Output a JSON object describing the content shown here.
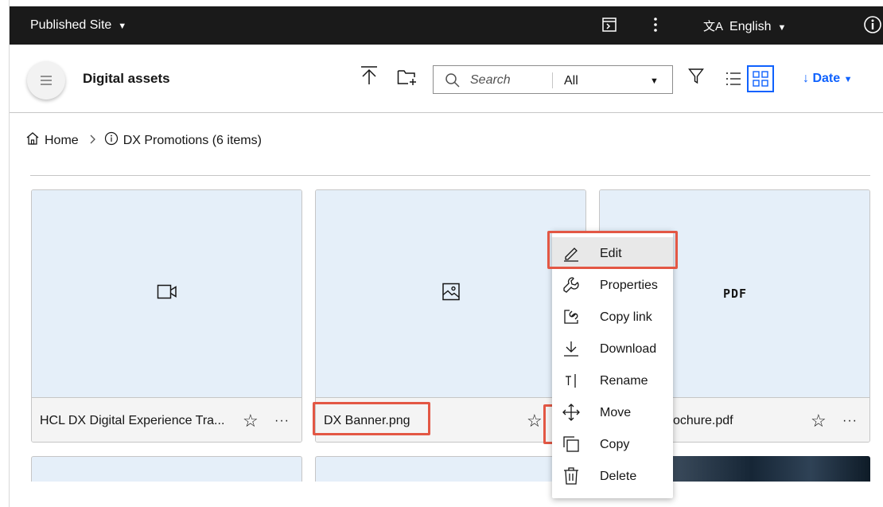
{
  "topbar": {
    "site_label": "Published Site",
    "language": "English",
    "language_glyph": "文A",
    "icons": [
      "terminal-icon",
      "overflow-menu-icon",
      "translate-icon",
      "info-icon"
    ]
  },
  "toolbar": {
    "title": "Digital assets",
    "search_placeholder": "Search",
    "filter_value": "All",
    "sort_label": "Date"
  },
  "breadcrumb": {
    "home": "Home",
    "current": "DX Promotions (6 items)"
  },
  "cards": [
    {
      "name": "HCL DX Digital Experience Tra...",
      "type_icon": "video-icon"
    },
    {
      "name": "DX Banner.png",
      "type_icon": "image-icon"
    },
    {
      "name": "ochure.pdf",
      "type_label": "PDF"
    }
  ],
  "context_menu": {
    "items": [
      {
        "label": "Edit",
        "icon": "edit-icon"
      },
      {
        "label": "Properties",
        "icon": "wrench-icon"
      },
      {
        "label": "Copy link",
        "icon": "copy-link-icon"
      },
      {
        "label": "Download",
        "icon": "download-icon"
      },
      {
        "label": "Rename",
        "icon": "rename-icon"
      },
      {
        "label": "Move",
        "icon": "move-icon"
      },
      {
        "label": "Copy",
        "icon": "copy-icon"
      },
      {
        "label": "Delete",
        "icon": "trash-icon"
      }
    ]
  },
  "colors": {
    "topbar_bg": "#1a1a1a",
    "accent": "#0f62fe",
    "thumb_bg": "#e5eff9",
    "highlight": "#e35744"
  }
}
